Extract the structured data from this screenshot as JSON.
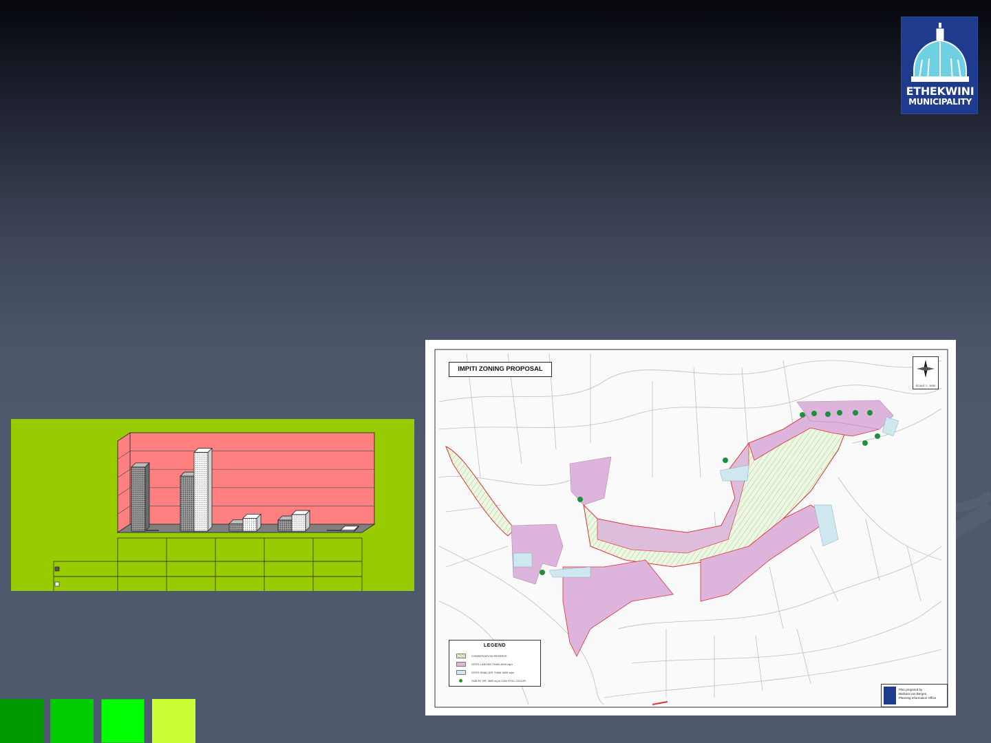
{
  "logo": {
    "line1": "ETHEKWINI",
    "line2": "MUNICIPALITY"
  },
  "map": {
    "title": "IMPITI ZONING PROPOSAL",
    "scale": "SCALE 1 : 5000",
    "legend": {
      "title": "LEGEND",
      "items": [
        {
          "label": "CONSERVATION RESERVE",
          "color": "#e8f3dc",
          "icon": "hatch-swatch"
        },
        {
          "label": "SITES LARGER THAN 3600 sqm",
          "color": "#dcb4dc",
          "icon": "pink-swatch"
        },
        {
          "label": "SITES SMALLER THAN 3600 sqm",
          "color": "#cfe7ee",
          "icon": "blue-swatch"
        },
        {
          "label": "SUB BY SR: 3600 sq m CAN STILL OCCUR",
          "color": "#1e8f3c",
          "icon": "green-dot"
        }
      ]
    },
    "credit": {
      "line1": "Plan prepared by :",
      "line2": "Barbara von Bergen",
      "line3": "Planning Information Office"
    }
  },
  "chart_data": {
    "type": "bar",
    "categories": [
      "",
      "",
      "",
      "",
      ""
    ],
    "series": [
      {
        "values": [
          3.5,
          3.0,
          0.4,
          0.6,
          0.0
        ],
        "color": "#7a7a7a"
      },
      {
        "values": [
          0.0,
          4.3,
          0.7,
          0.9,
          0.05
        ],
        "color": "#e6e6e6"
      }
    ],
    "ylim": [
      0,
      5
    ],
    "plot_background": "#ff8080",
    "panel_background": "#99cc00"
  },
  "colors": {
    "swatches": [
      "#009900",
      "#00cc00",
      "#00ff00",
      "#ccff33"
    ]
  }
}
